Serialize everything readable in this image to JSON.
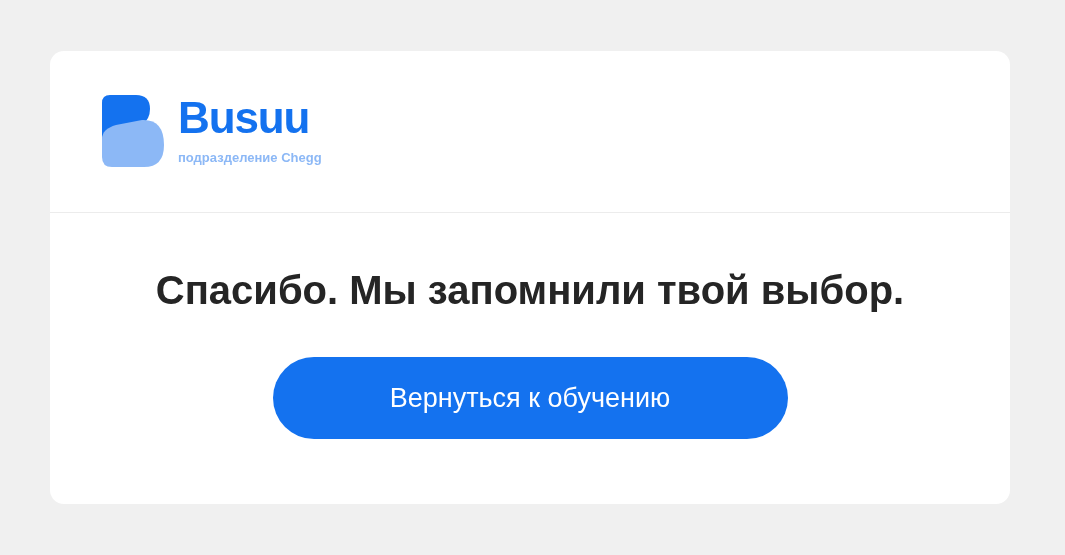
{
  "logo": {
    "name": "Busuu",
    "tagline": "подразделение Chegg"
  },
  "message": "Спасибо. Мы запомнили твой выбор.",
  "button": "Вернуться к обучению"
}
